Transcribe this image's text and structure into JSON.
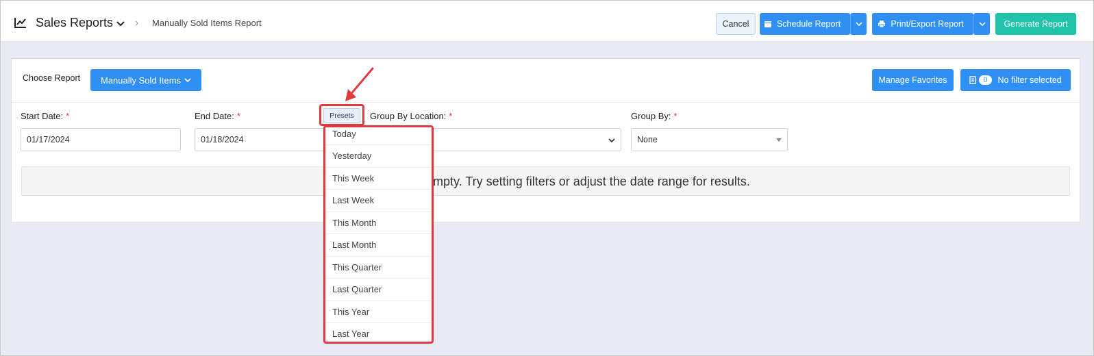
{
  "header": {
    "title": "Sales Reports",
    "breadcrumb": "Manually Sold Items Report",
    "cancel_label": "Cancel",
    "schedule_label": "Schedule Report",
    "print_label": "Print/Export Report",
    "generate_label": "Generate Report"
  },
  "toolbar": {
    "choose_label": "Choose Report",
    "choose_value": "Manually Sold Items",
    "manage_favorites_label": "Manage Favorites",
    "filter_count": "0",
    "filter_label": "No filter selected"
  },
  "filters": {
    "start_date_label": "Start Date:",
    "start_date_value": "01/17/2024",
    "end_date_label": "End Date:",
    "end_date_value": "01/18/2024",
    "group_location_label": "Group By Location:",
    "group_by_label": "Group By:",
    "group_by_value": "None",
    "required_mark": "*"
  },
  "presets": {
    "button_label": "Presets",
    "items": [
      "Today",
      "Yesterday",
      "This Week",
      "Last Week",
      "This Month",
      "Last Month",
      "This Quarter",
      "Last Quarter",
      "This Year",
      "Last Year"
    ]
  },
  "empty_message": "mpty. Try setting filters or adjust the date range for results.",
  "colors": {
    "primary": "#2f8ff2",
    "generate": "#1fc3a9",
    "highlight": "#e03a3e",
    "background": "#e9eaf4"
  }
}
